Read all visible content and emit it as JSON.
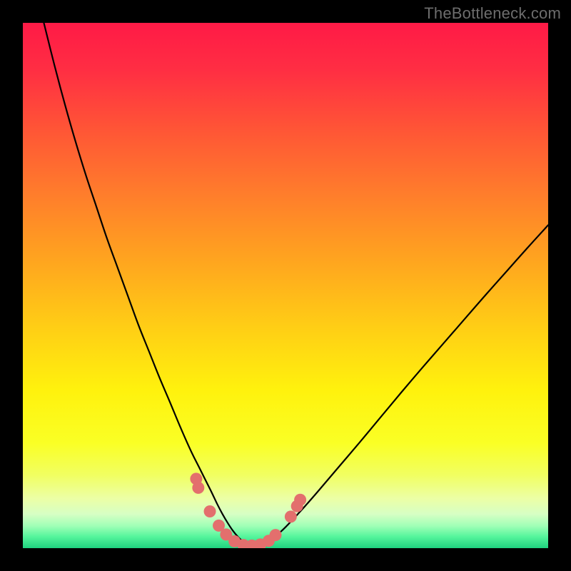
{
  "watermark": "TheBottleneck.com",
  "chart_data": {
    "type": "line",
    "title": "",
    "xlabel": "",
    "ylabel": "",
    "xlim": [
      0,
      100
    ],
    "ylim": [
      0,
      100
    ],
    "grid": false,
    "legend": false,
    "gradient_stops": [
      {
        "offset": 0.0,
        "color": "#ff1a46"
      },
      {
        "offset": 0.09,
        "color": "#ff2e43"
      },
      {
        "offset": 0.2,
        "color": "#ff5436"
      },
      {
        "offset": 0.32,
        "color": "#ff7b2c"
      },
      {
        "offset": 0.45,
        "color": "#ffa41f"
      },
      {
        "offset": 0.58,
        "color": "#ffce15"
      },
      {
        "offset": 0.7,
        "color": "#fff20d"
      },
      {
        "offset": 0.8,
        "color": "#faff25"
      },
      {
        "offset": 0.86,
        "color": "#f1ff60"
      },
      {
        "offset": 0.905,
        "color": "#ecffa5"
      },
      {
        "offset": 0.935,
        "color": "#d7ffc4"
      },
      {
        "offset": 0.958,
        "color": "#9fffb6"
      },
      {
        "offset": 0.978,
        "color": "#55f59c"
      },
      {
        "offset": 1.0,
        "color": "#1fd27f"
      }
    ],
    "series": [
      {
        "name": "bottleneck-curve",
        "color": "#000000",
        "x": [
          4,
          6,
          8,
          10,
          12,
          14,
          16,
          18,
          20,
          22,
          24,
          26,
          28,
          30,
          32,
          33.5,
          35,
          36,
          37,
          38,
          39,
          40,
          41,
          42,
          43,
          44.5,
          46,
          48,
          50,
          53,
          56,
          60,
          64,
          68,
          72,
          76,
          80,
          84,
          88,
          92,
          96,
          100
        ],
        "y": [
          100,
          92,
          84.5,
          77.5,
          71,
          65,
          59,
          53.5,
          48,
          42.5,
          37.5,
          32.5,
          27.8,
          23,
          18.5,
          15.5,
          12.5,
          10.5,
          8.4,
          6.5,
          4.8,
          3.3,
          2.1,
          1.2,
          0.6,
          0.5,
          0.9,
          2.2,
          4.0,
          7.2,
          10.6,
          15.3,
          20.0,
          24.8,
          29.6,
          34.3,
          38.9,
          43.5,
          48.1,
          52.6,
          57.1,
          61.5
        ]
      },
      {
        "name": "marker-dots",
        "color": "#e36f6d",
        "type": "scatter",
        "points": [
          {
            "x": 33.0,
            "y": 13.2
          },
          {
            "x": 33.4,
            "y": 11.5
          },
          {
            "x": 35.6,
            "y": 7.0
          },
          {
            "x": 37.3,
            "y": 4.3
          },
          {
            "x": 38.7,
            "y": 2.6
          },
          {
            "x": 40.3,
            "y": 1.3
          },
          {
            "x": 42.0,
            "y": 0.6
          },
          {
            "x": 43.6,
            "y": 0.5
          },
          {
            "x": 45.2,
            "y": 0.7
          },
          {
            "x": 46.8,
            "y": 1.4
          },
          {
            "x": 48.1,
            "y": 2.5
          },
          {
            "x": 51.0,
            "y": 6.0
          },
          {
            "x": 52.2,
            "y": 8.0
          },
          {
            "x": 52.8,
            "y": 9.2
          }
        ]
      }
    ]
  }
}
